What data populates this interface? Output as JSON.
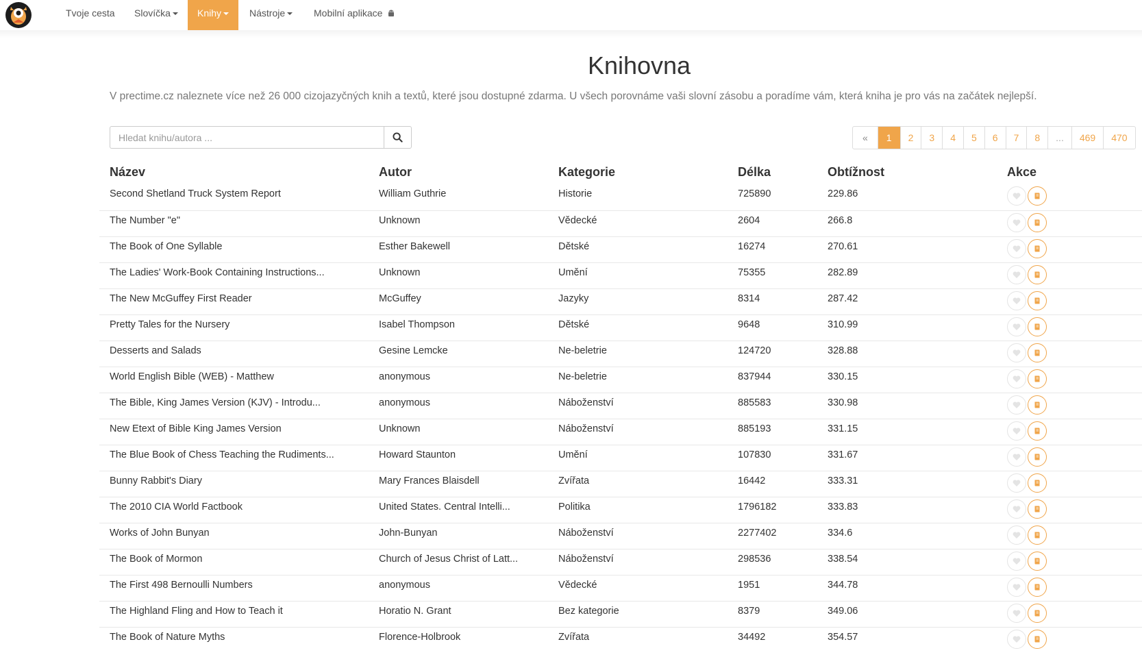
{
  "nav": {
    "logo": "owl-logo",
    "items": [
      {
        "label": "Tvoje cesta",
        "dropdown": false
      },
      {
        "label": "Slovíčka",
        "dropdown": true
      },
      {
        "label": "Knihy",
        "dropdown": true,
        "active": true
      },
      {
        "label": "Nástroje",
        "dropdown": true
      },
      {
        "label": "Mobilní aplikace",
        "dropdown": false,
        "icon": "android-icon"
      }
    ]
  },
  "page": {
    "title": "Knihovna",
    "intro": "V prectime.cz naleznete více než 26 000 cizojazyčných knih a textů, které jsou dostupné zdarma. U všech porovnáme vaši slovní zásobu a poradíme vám, která kniha je pro vás na začátek nejlepší."
  },
  "search": {
    "placeholder": "Hledat knihu/autora ...",
    "icon": "search-icon"
  },
  "pagination": [
    "«",
    "1",
    "2",
    "3",
    "4",
    "5",
    "6",
    "7",
    "8",
    "...",
    "469",
    "470"
  ],
  "pagination_active": "1",
  "table": {
    "headers": [
      "Název",
      "Autor",
      "Kategorie",
      "Délka",
      "Obtížnost",
      "Akce"
    ],
    "rows": [
      [
        "Second Shetland Truck System Report",
        "William Guthrie",
        "Historie",
        "725890",
        "229.86"
      ],
      [
        "The Number \"e\"",
        "Unknown",
        "Vědecké",
        "2604",
        "266.8"
      ],
      [
        "The Book of One Syllable",
        "Esther Bakewell",
        "Dětské",
        "16274",
        "270.61"
      ],
      [
        "The Ladies' Work-Book Containing Instructions...",
        "Unknown",
        "Umění",
        "75355",
        "282.89"
      ],
      [
        "The New McGuffey First Reader",
        "McGuffey",
        "Jazyky",
        "8314",
        "287.42"
      ],
      [
        "Pretty Tales for the Nursery",
        "Isabel Thompson",
        "Dětské",
        "9648",
        "310.99"
      ],
      [
        "Desserts and Salads",
        "Gesine Lemcke",
        "Ne-beletrie",
        "124720",
        "328.88"
      ],
      [
        "World English Bible (WEB) - Matthew",
        "anonymous",
        "Ne-beletrie",
        "837944",
        "330.15"
      ],
      [
        "The Bible, King James Version (KJV) - Introdu...",
        "anonymous",
        "Náboženství",
        "885583",
        "330.98"
      ],
      [
        "New Etext of Bible King James Version",
        "Unknown",
        "Náboženství",
        "885193",
        "331.15"
      ],
      [
        "The Blue Book of Chess Teaching the Rudiments...",
        "Howard Staunton",
        "Umění",
        "107830",
        "331.67"
      ],
      [
        "Bunny Rabbit's Diary",
        "Mary Frances Blaisdell",
        "Zvířata",
        "16442",
        "333.31"
      ],
      [
        "The 2010 CIA World Factbook",
        "United States. Central Intelli...",
        "Politika",
        "1796182",
        "333.83"
      ],
      [
        "Works of John Bunyan",
        "John-Bunyan",
        "Náboženství",
        "2277402",
        "334.6"
      ],
      [
        "The Book of Mormon",
        "Church of Jesus Christ of Latt...",
        "Náboženství",
        "298536",
        "338.54"
      ],
      [
        "The First 498 Bernoulli Numbers",
        "anonymous",
        "Vědecké",
        "1951",
        "344.78"
      ],
      [
        "The Highland Fling and How to Teach it",
        "Horatio N. Grant",
        "Bez kategorie",
        "8379",
        "349.06"
      ],
      [
        "The Book of Nature Myths",
        "Florence-Holbrook",
        "Zvířata",
        "34492",
        "354.57"
      ]
    ],
    "action_icons": [
      "heart-icon",
      "book-icon"
    ]
  },
  "colors": {
    "accent": "#f0a54a",
    "text": "#333333",
    "muted": "#777777",
    "border": "#e8e8e8"
  }
}
